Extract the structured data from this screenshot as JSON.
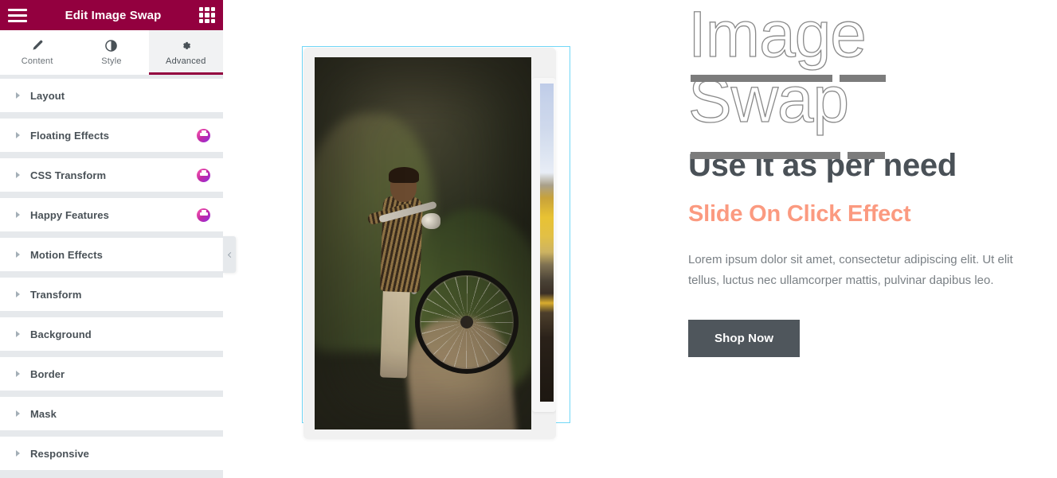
{
  "panel": {
    "header": {
      "title": "Edit Image Swap",
      "menu_icon": "hamburger-icon",
      "widgets_icon": "grid-icon"
    },
    "tabs": [
      {
        "label": "Content",
        "icon": "pencil-icon",
        "active": false
      },
      {
        "label": "Style",
        "icon": "contrast-icon",
        "active": false
      },
      {
        "label": "Advanced",
        "icon": "gear-icon",
        "active": true
      }
    ],
    "sections": [
      {
        "label": "Layout",
        "badge": false
      },
      {
        "label": "Floating Effects",
        "badge": true
      },
      {
        "label": "CSS Transform",
        "badge": true
      },
      {
        "label": "Happy Features",
        "badge": true
      },
      {
        "label": "Motion Effects",
        "badge": false
      },
      {
        "label": "Transform",
        "badge": false
      },
      {
        "label": "Background",
        "badge": false
      },
      {
        "label": "Border",
        "badge": false
      },
      {
        "label": "Mask",
        "badge": false
      },
      {
        "label": "Responsive",
        "badge": false
      }
    ],
    "collapse_handle_icon": "chevron-left-icon"
  },
  "canvas": {
    "widget": {
      "name": "image-swap-widget",
      "front_image_alt": "boy with bicycle on hillside path",
      "back_image_alt": "partially revealed second image"
    },
    "content": {
      "outline_title_line1": "Image",
      "outline_title_line2": "Swap",
      "heading": "Use it as per need",
      "subheading": "Slide On Click Effect",
      "paragraph": "Lorem ipsum dolor sit amet, consectetur adipiscing elit. Ut elit tellus, luctus nec ullamcorper mattis, pulvinar dapibus leo.",
      "button_label": "Shop Now"
    }
  },
  "colors": {
    "panel_header": "#93003f",
    "tab_active_indicator": "#93003f",
    "panel_bg": "#e6e9ec",
    "section_row_bg": "#ffffff",
    "section_label": "#495157",
    "heading": "#4a5157",
    "subheading": "#fb9a80",
    "paragraph": "#7a8085",
    "button_bg": "#4f565c",
    "button_text": "#ffffff",
    "outline_stroke": "#8a8a8a",
    "underline_bar": "#7c7c7c",
    "selection_border": "#71d7f7"
  }
}
